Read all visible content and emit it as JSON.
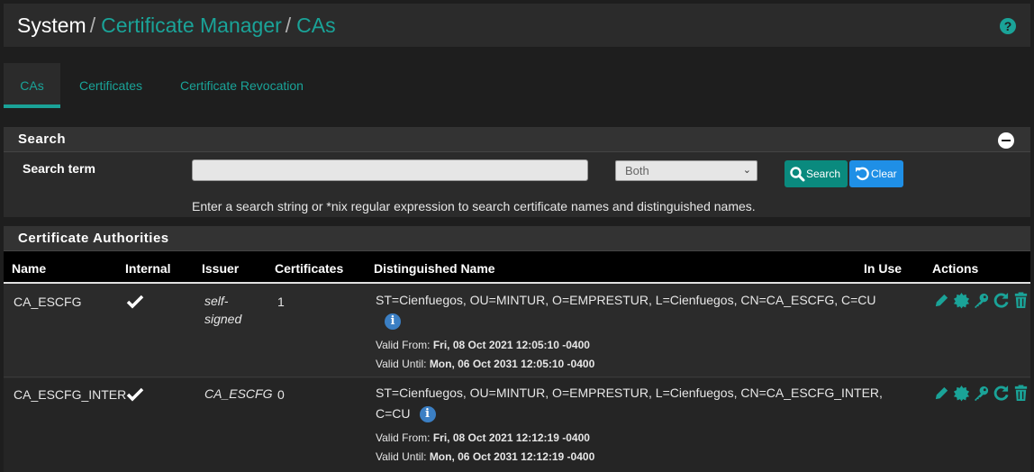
{
  "breadcrumb": {
    "root": "System",
    "sep1": "/",
    "level2": "Certificate Manager",
    "sep2": "/",
    "level3": "CAs"
  },
  "help_icon": "question-circle-icon",
  "tabs": [
    {
      "label": "CAs",
      "active": true
    },
    {
      "label": "Certificates",
      "active": false
    },
    {
      "label": "Certificate Revocation",
      "active": false
    }
  ],
  "search_panel": {
    "title": "Search",
    "term_label": "Search term",
    "input_value": "",
    "scope_selected": "Both",
    "search_button": "Search",
    "clear_button": "Clear",
    "help_text": "Enter a search string or *nix regular expression to search certificate names and distinguished names."
  },
  "ca_panel": {
    "title": "Certificate Authorities",
    "columns": [
      "Name",
      "Internal",
      "Issuer",
      "Certificates",
      "Distinguished Name",
      "In Use",
      "Actions"
    ],
    "rows": [
      {
        "name": "CA_ESCFG",
        "internal": true,
        "issuer_line1": "self-",
        "issuer_line2": "signed",
        "certificates": "1",
        "dn_line1": "ST=Cienfuegos, OU=MINTUR, O=EMPRESTUR, L=Cienfuegos, CN=CA_ESCFG, C=CU",
        "dn_line2": "",
        "valid_from_label": "Valid From:",
        "valid_from": "Fri, 08 Oct 2021 12:05:10 -0400",
        "valid_until_label": "Valid Until:",
        "valid_until": "Mon, 06 Oct 2031 12:05:10 -0400",
        "in_use": ""
      },
      {
        "name": "CA_ESCFG_INTER",
        "internal": true,
        "issuer_line1": "CA_ESCFG",
        "issuer_line2": "",
        "certificates": "0",
        "dn_line1": "ST=Cienfuegos, OU=MINTUR, O=EMPRESTUR, L=Cienfuegos, CN=CA_ESCFG_INTER,",
        "dn_line2": "C=CU",
        "valid_from_label": "Valid From:",
        "valid_from": "Fri, 08 Oct 2021 12:12:19 -0400",
        "valid_until_label": "Valid Until:",
        "valid_until": "Mon, 06 Oct 2031 12:12:19 -0400",
        "in_use": ""
      }
    ],
    "action_icons": [
      "pencil-icon",
      "certificate-icon",
      "key-icon",
      "refresh-icon",
      "trash-icon"
    ]
  },
  "colors": {
    "accent": "#1aa398",
    "background": "#1e1e1e",
    "panel": "#2b2b2b",
    "info_blue": "#3b7fc4",
    "clear_blue": "#1f8fe6"
  }
}
